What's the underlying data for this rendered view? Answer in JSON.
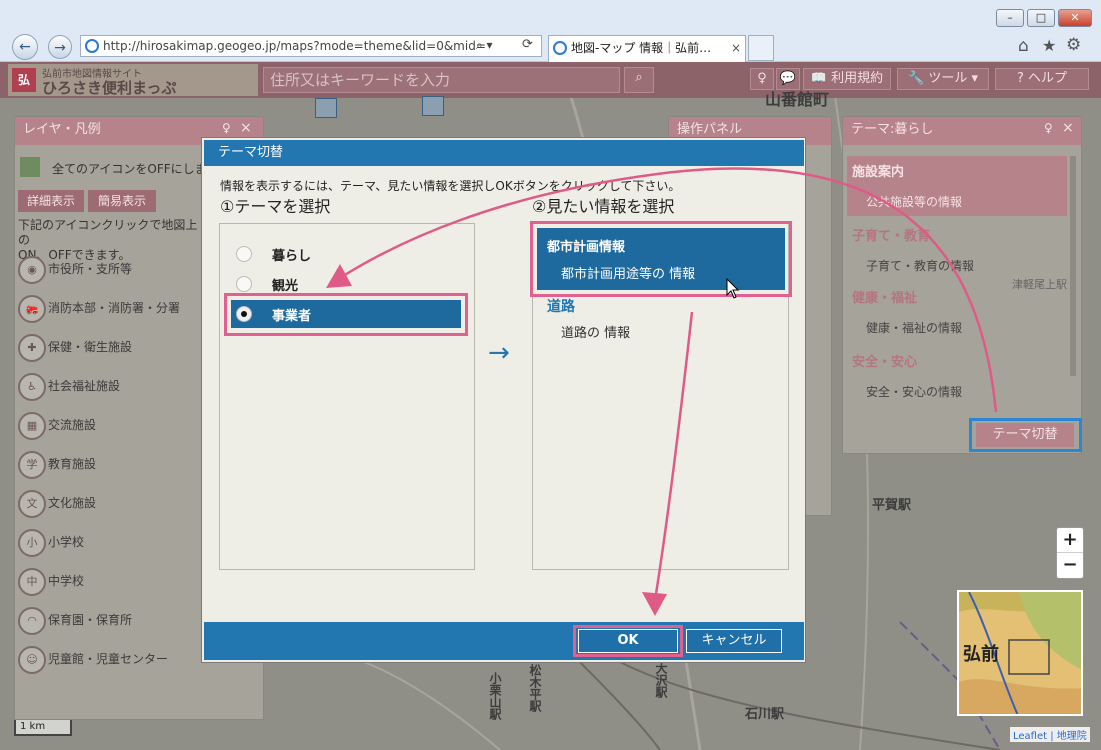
{
  "browser": {
    "url": "http://hirosakimap.geogeo.jp/maps?mode=theme&lid=0&mid=",
    "tab_title": "地図-マップ 情報｜弘前…",
    "back_icon": "←",
    "forward_icon": "→",
    "search_glyph": "⌕ ▾",
    "refresh_glyph": "⟳",
    "home_icon": "⌂",
    "star_icon": "★",
    "gear_icon": "⚙",
    "minimize": "–",
    "maximize": "□",
    "close": "✕",
    "tab_close": "×"
  },
  "app": {
    "logo_line1": "弘前市地図情報サイト",
    "logo_line2": "ひろさき便利まっぷ",
    "search_placeholder": "住所又はキーワードを入力",
    "search_glyph": "⌕",
    "btn_bulb": "♀",
    "btn_chat": "💬",
    "terms_label": "📖 利用規約",
    "tools_label": "🔧 ツール ▾",
    "help_label": "? ヘルプ"
  },
  "layer_panel": {
    "title": "レイヤ・凡例",
    "pin": "♀",
    "close": "×",
    "all_off": "全てのアイコンをOFFにしま",
    "detail_btn": "詳細表示",
    "simple_btn": "簡易表示",
    "desc": "下記のアイコンクリックで地図上の\nON、OFFできます。",
    "items": [
      {
        "label": "市役所・支所等",
        "icon": "◉"
      },
      {
        "label": "消防本部・消防署・分署",
        "icon": "🚒"
      },
      {
        "label": "保健・衛生施設",
        "icon": "✚"
      },
      {
        "label": "社会福祉施設",
        "icon": "♿"
      },
      {
        "label": "交流施設",
        "icon": "▦"
      },
      {
        "label": "教育施設",
        "icon": "学"
      },
      {
        "label": "文化施設",
        "icon": "文"
      },
      {
        "label": "小学校",
        "icon": "小"
      },
      {
        "label": "中学校",
        "icon": "中"
      },
      {
        "label": "保育園・保育所",
        "icon": "◠"
      },
      {
        "label": "児童館・児童センター",
        "icon": "☺"
      }
    ]
  },
  "ops_panel": {
    "title": "操作パネル"
  },
  "theme_panel": {
    "title": "テーマ:暮らし",
    "sections": [
      {
        "head": "施設案内",
        "item": "公共施設等の情報"
      },
      {
        "head": "子育て・教育",
        "item": "子育て・教育の情報"
      },
      {
        "head": "健康・福祉",
        "item": "健康・福祉の情報"
      },
      {
        "head": "安全・安心",
        "item": "安全・安心の情報"
      }
    ],
    "switch_btn": "テーマ切替"
  },
  "dialog": {
    "title": "テーマ切替",
    "instruction": "情報を表示するには、テーマ、見たい情報を選択しOKボタンをクリックして下さい。",
    "step1": "①テーマを選択",
    "step2": "②見たい情報を選択",
    "themes": [
      {
        "label": "暮らし",
        "selected": false
      },
      {
        "label": "観光",
        "selected": false
      },
      {
        "label": "事業者",
        "selected": true
      }
    ],
    "arrow": "→",
    "info": [
      {
        "head": "都市計画情報",
        "item": "都市計画用途等の 情報",
        "selected": true
      },
      {
        "head": "道路",
        "item": "道路の 情報",
        "selected": false
      }
    ],
    "ok": "OK",
    "cancel": "キャンセル"
  },
  "map": {
    "labels": {
      "top": "山番館町",
      "hiraga": "平賀駅",
      "ohzawa": "大沢駅",
      "matsukitai": "松木平駅",
      "koguriyama": "小栗山駅",
      "ishikawa": "石川駅",
      "tsugaru": "津軽尾上駅"
    },
    "scale": "1 km",
    "zoom_in": "+",
    "zoom_out": "−",
    "minimap_label": "弘前",
    "attribution": "Leaflet | 地理院"
  },
  "colors": {
    "accent": "#2277b0",
    "highlight": "#e06090",
    "header": "#8b6369"
  }
}
